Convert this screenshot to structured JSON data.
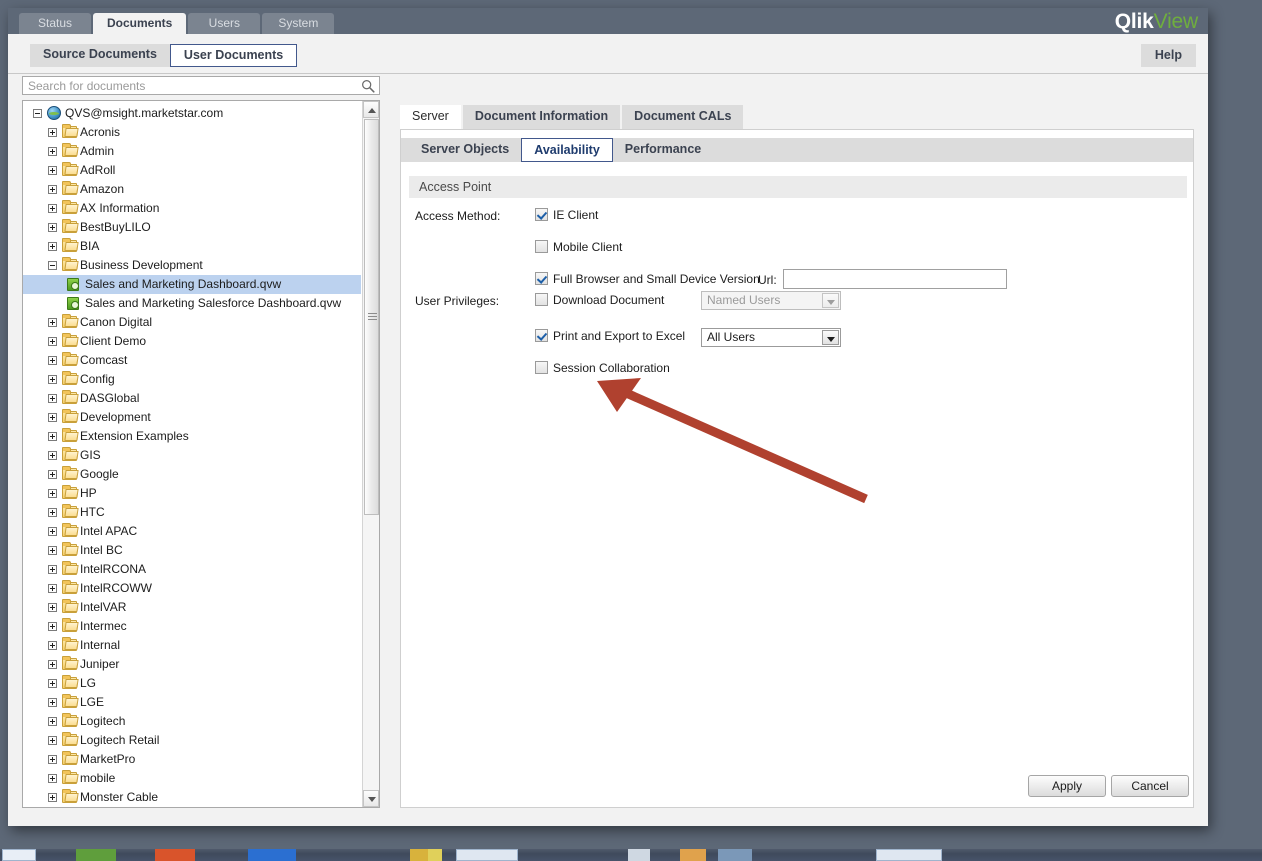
{
  "brand": {
    "logo_primary": "Qlik",
    "logo_secondary": "View",
    "accent_green": "#6fae3e",
    "header_bg": "#5d6877",
    "selection_blue": "#bcd2ef",
    "annotation_red": "#b0412f"
  },
  "main_tabs": [
    {
      "label": "Status",
      "active": false
    },
    {
      "label": "Documents",
      "active": true
    },
    {
      "label": "Users",
      "active": false
    },
    {
      "label": "System",
      "active": false
    }
  ],
  "sub_tabs": [
    {
      "label": "Source Documents",
      "active": false
    },
    {
      "label": "User Documents",
      "active": true
    }
  ],
  "help_label": "Help",
  "search": {
    "placeholder": "Search for documents",
    "value": "",
    "icon": "search-icon"
  },
  "tree": {
    "root": {
      "label": "QVS@msight.marketstar.com",
      "icon": "server-globe-icon",
      "expanded": true
    },
    "items": [
      {
        "label": "Acronis",
        "type": "folder",
        "expanded": false,
        "depth": 1
      },
      {
        "label": "Admin",
        "type": "folder",
        "expanded": false,
        "depth": 1
      },
      {
        "label": "AdRoll",
        "type": "folder",
        "expanded": false,
        "depth": 1
      },
      {
        "label": "Amazon",
        "type": "folder",
        "expanded": false,
        "depth": 1
      },
      {
        "label": "AX Information",
        "type": "folder",
        "expanded": false,
        "depth": 1
      },
      {
        "label": "BestBuyLILO",
        "type": "folder",
        "expanded": false,
        "depth": 1
      },
      {
        "label": "BIA",
        "type": "folder",
        "expanded": false,
        "depth": 1
      },
      {
        "label": "Business Development",
        "type": "folder",
        "expanded": true,
        "depth": 1
      },
      {
        "label": "Sales and Marketing Dashboard.qvw",
        "type": "document",
        "depth": 2,
        "selected": true
      },
      {
        "label": "Sales and Marketing Salesforce Dashboard.qvw",
        "type": "document",
        "depth": 2,
        "selected": false
      },
      {
        "label": "Canon Digital",
        "type": "folder",
        "expanded": false,
        "depth": 1
      },
      {
        "label": "Client Demo",
        "type": "folder",
        "expanded": false,
        "depth": 1
      },
      {
        "label": "Comcast",
        "type": "folder",
        "expanded": false,
        "depth": 1
      },
      {
        "label": "Config",
        "type": "folder",
        "expanded": false,
        "depth": 1
      },
      {
        "label": "DASGlobal",
        "type": "folder",
        "expanded": false,
        "depth": 1
      },
      {
        "label": "Development",
        "type": "folder",
        "expanded": false,
        "depth": 1
      },
      {
        "label": "Extension Examples",
        "type": "folder",
        "expanded": false,
        "depth": 1
      },
      {
        "label": "GIS",
        "type": "folder",
        "expanded": false,
        "depth": 1
      },
      {
        "label": "Google",
        "type": "folder",
        "expanded": false,
        "depth": 1
      },
      {
        "label": "HP",
        "type": "folder",
        "expanded": false,
        "depth": 1
      },
      {
        "label": "HTC",
        "type": "folder",
        "expanded": false,
        "depth": 1
      },
      {
        "label": "Intel APAC",
        "type": "folder",
        "expanded": false,
        "depth": 1
      },
      {
        "label": "Intel BC",
        "type": "folder",
        "expanded": false,
        "depth": 1
      },
      {
        "label": "IntelRCONA",
        "type": "folder",
        "expanded": false,
        "depth": 1
      },
      {
        "label": "IntelRCOWW",
        "type": "folder",
        "expanded": false,
        "depth": 1
      },
      {
        "label": "IntelVAR",
        "type": "folder",
        "expanded": false,
        "depth": 1
      },
      {
        "label": "Intermec",
        "type": "folder",
        "expanded": false,
        "depth": 1
      },
      {
        "label": "Internal",
        "type": "folder",
        "expanded": false,
        "depth": 1
      },
      {
        "label": "Juniper",
        "type": "folder",
        "expanded": false,
        "depth": 1
      },
      {
        "label": "LG",
        "type": "folder",
        "expanded": false,
        "depth": 1
      },
      {
        "label": "LGE",
        "type": "folder",
        "expanded": false,
        "depth": 1
      },
      {
        "label": "Logitech",
        "type": "folder",
        "expanded": false,
        "depth": 1
      },
      {
        "label": "Logitech Retail",
        "type": "folder",
        "expanded": false,
        "depth": 1
      },
      {
        "label": "MarketPro",
        "type": "folder",
        "expanded": false,
        "depth": 1
      },
      {
        "label": "mobile",
        "type": "folder",
        "expanded": false,
        "depth": 1
      },
      {
        "label": "Monster Cable",
        "type": "folder",
        "expanded": false,
        "depth": 1
      }
    ]
  },
  "doc_tabs": [
    {
      "label": "Server",
      "active": true
    },
    {
      "label": "Document Information",
      "active": false
    },
    {
      "label": "Document CALs",
      "active": false
    }
  ],
  "level_tabs": [
    {
      "label": "Server Objects",
      "active": false
    },
    {
      "label": "Availability",
      "active": true
    },
    {
      "label": "Performance",
      "active": false
    }
  ],
  "section": {
    "title": "Access Point"
  },
  "form": {
    "access_method_label": "Access Method:",
    "access_method": [
      {
        "label": "IE Client",
        "checked": true
      },
      {
        "label": "Mobile Client",
        "checked": false
      },
      {
        "label": "Full Browser and Small Device Version",
        "checked": true
      }
    ],
    "url_label": "Url:",
    "url_value": "",
    "user_privileges_label": "User Privileges:",
    "user_privileges": [
      {
        "label": "Download Document",
        "checked": false,
        "select_value": "Named Users",
        "select_disabled": true,
        "options": [
          "Named Users",
          "All Users"
        ]
      },
      {
        "label": "Print and Export to Excel",
        "checked": true,
        "select_value": "All Users",
        "select_disabled": false,
        "options": [
          "Named Users",
          "All Users"
        ]
      },
      {
        "label": "Session Collaboration",
        "checked": false,
        "select_value": null,
        "select_disabled": false,
        "options": []
      }
    ]
  },
  "actions": {
    "apply_label": "Apply",
    "cancel_label": "Cancel"
  }
}
